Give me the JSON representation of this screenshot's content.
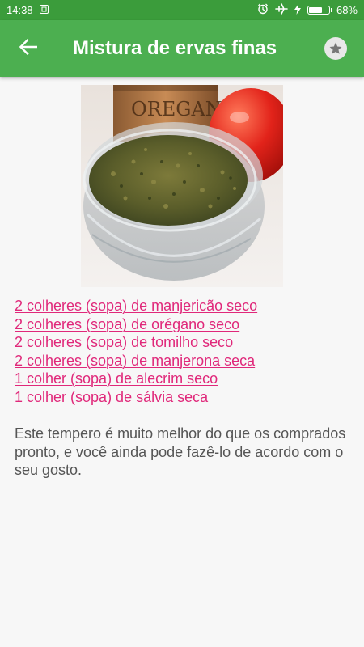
{
  "status_bar": {
    "time": "14:38",
    "battery_percent_text": "68%",
    "battery_level": 0.68,
    "icons": [
      "notification-icon",
      "alarm-icon",
      "airplane-mode-icon",
      "charging-icon",
      "battery-icon"
    ]
  },
  "app_bar": {
    "title": "Mistura de ervas finas",
    "back_icon": "arrow-back-icon",
    "favorite_icon": "star-icon"
  },
  "image": {
    "description_visible_text": "OREGANO"
  },
  "ingredients": [
    "2 colheres (sopa) de manjericão seco",
    "2 colheres (sopa) de orégano seco",
    "2 colheres (sopa) de tomilho seco",
    "2 colheres (sopa) de manjerona seca",
    "1 colher (sopa) de alecrim seco",
    "1 colher (sopa) de sálvia seca"
  ],
  "description": "Este tempero é muito melhor do que os comprados pronto, e você ainda pode fazê-lo de acordo com o seu gosto.",
  "colors": {
    "status_bar": "#3b9c3b",
    "app_bar": "#4caf50",
    "link": "#e0287a",
    "body_text": "#555555",
    "background": "#f7f7f7"
  }
}
